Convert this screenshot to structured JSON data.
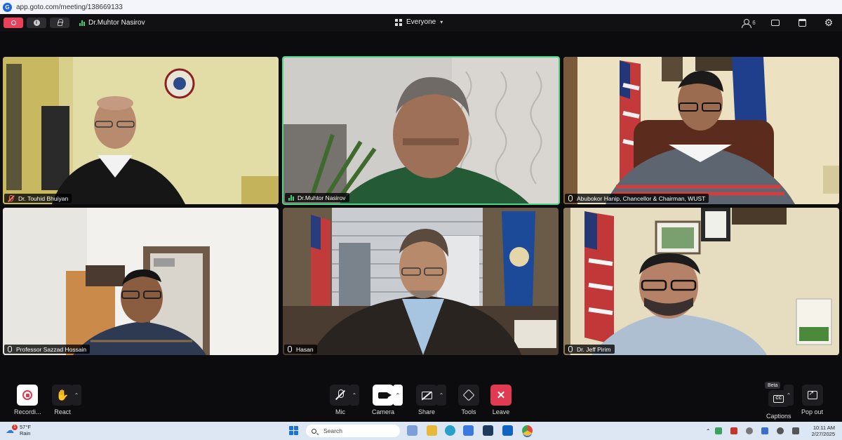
{
  "browser": {
    "url": "app.goto.com/meeting/138669133"
  },
  "topbar": {
    "active_speaker": "Dr.Muhtor Nasirov",
    "view_mode": "Everyone",
    "participant_count": "6"
  },
  "tiles": [
    {
      "name": "Dr. Touhid Bhuiyan",
      "mic": "muted"
    },
    {
      "name": "Dr.Muhtor Nasirov",
      "mic": "speaking"
    },
    {
      "name": "Abubokor Hanip, Chancellor & Chairman, WUST",
      "mic": "on"
    },
    {
      "name": "Professor Sazzad Hossain",
      "mic": "on"
    },
    {
      "name": "Hasan",
      "mic": "on"
    },
    {
      "name": "Dr. Jeff Pirim",
      "mic": "on"
    }
  ],
  "controls": {
    "recording_label": "Recordi...",
    "react_label": "React",
    "mic_label": "Mic",
    "camera_label": "Camera",
    "share_label": "Share",
    "tools_label": "Tools",
    "leave_label": "Leave",
    "captions_label": "Captions",
    "captions_badge": "Beta",
    "popout_label": "Pop out"
  },
  "taskbar": {
    "weather_temp": "57°F",
    "weather_cond": "Rain",
    "weather_badge": "1",
    "search_placeholder": "Search",
    "time": "10:11 AM",
    "date": "2/27/2025"
  },
  "colors": {
    "active_border": "#4cd68a",
    "leave_red": "#e03b52",
    "recording_red": "#e9415a"
  }
}
